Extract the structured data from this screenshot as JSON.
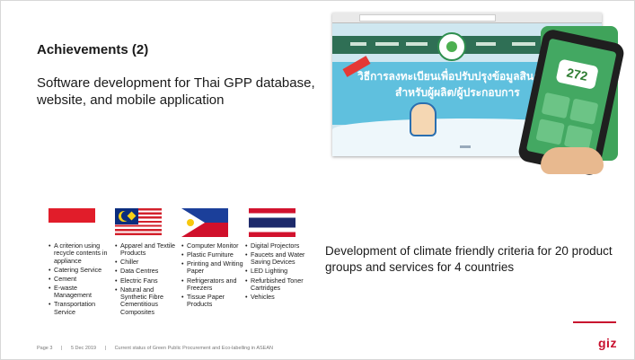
{
  "slide": {
    "heading": "Achievements (2)",
    "subtitle": "Software development for Thai GPP database, website, and mobile application",
    "criteria": "Development of climate friendly criteria for 20 product groups and services for 4 countries"
  },
  "collage": {
    "phone_counter": "272",
    "banner_line1": "วิธีการลงทะเบียนเพื่อปรับปรุงข้อมูลสินค้าและบริการ",
    "banner_line2": "สำหรับผู้ผลิต/ผู้ประกอบการ"
  },
  "countries": [
    {
      "flag": "indonesia-flag",
      "items": [
        "A criterion using recycle contents in appliance",
        "Catering Service",
        "Cement",
        "E-waste Management",
        "Transportation Service"
      ]
    },
    {
      "flag": "malaysia-flag",
      "items": [
        "Apparel and Textile Products",
        "Chiller",
        "Data Centres",
        "Electric Fans",
        "Natural and Synthetic Fibre Cementitious Composites"
      ]
    },
    {
      "flag": "philippines-flag",
      "items": [
        "Computer Monitor",
        "Plastic Furniture",
        "Printing and Writing Paper",
        "Refrigerators and Freezers",
        "Tissue Paper Products"
      ]
    },
    {
      "flag": "thailand-flag",
      "items": [
        "Digital Projectors",
        "Faucets and Water Saving Devices",
        "LED Lighting",
        "Refurbished Toner Cartridges",
        "Vehicles"
      ]
    }
  ],
  "footer": {
    "page": "Page 3",
    "date": "5 Dec 2019",
    "title": "Current status of Green Public Procurement and Eco-labelling in ASEAN"
  },
  "brand": {
    "logo_text": "giz",
    "accent_color": "#c8102e"
  }
}
